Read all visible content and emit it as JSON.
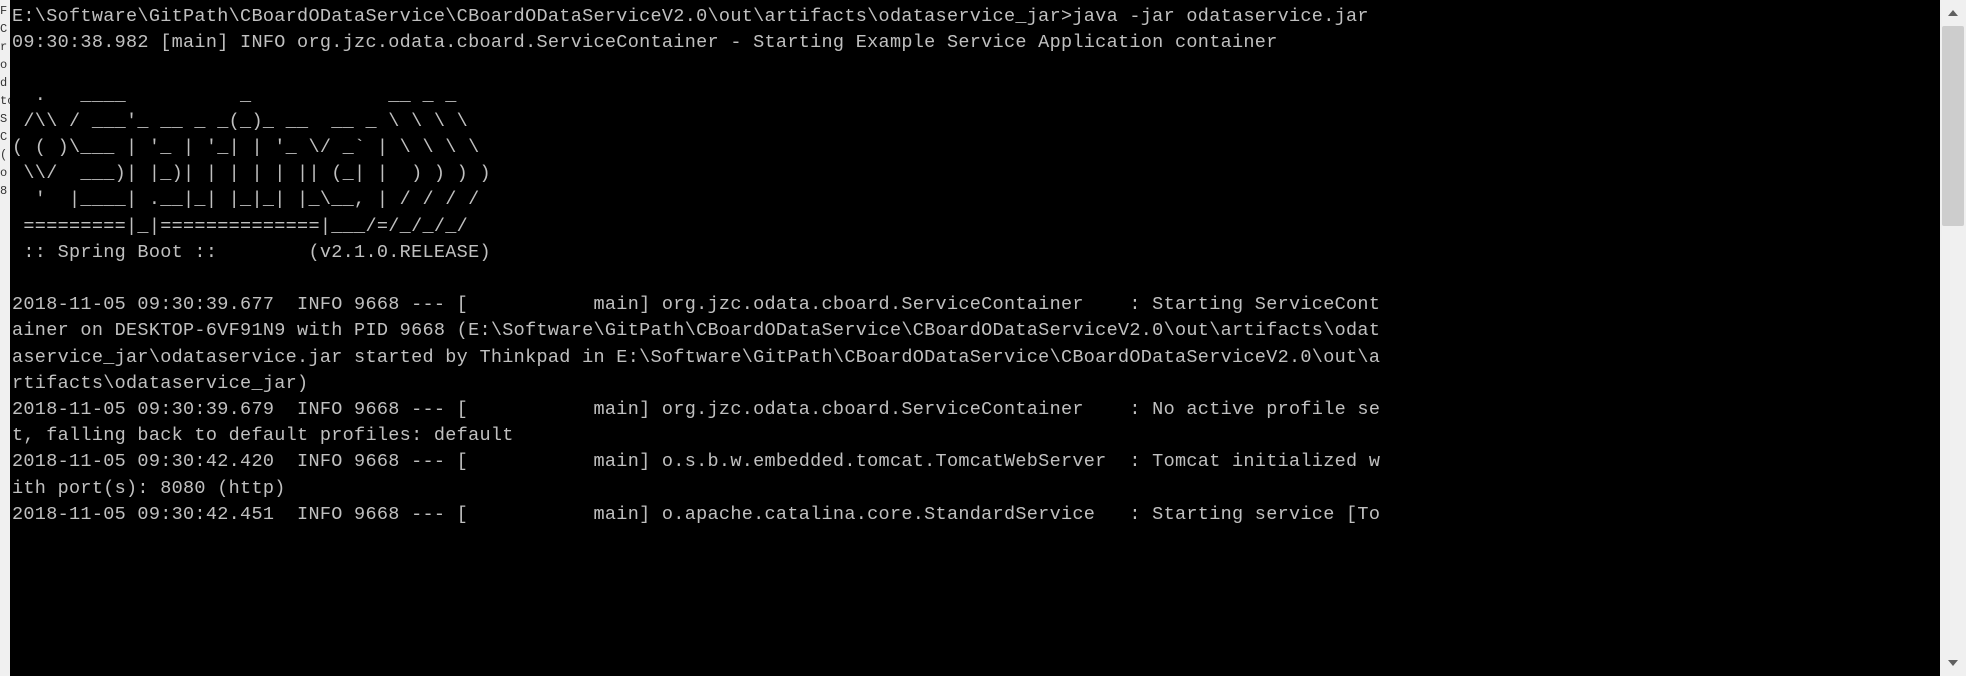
{
  "left_edge_text": "F\nC\n \nr\no\nd\nto\nS\nC\n(\no\n \n \n \n8",
  "terminal": {
    "prompt_line": "E:\\Software\\GitPath\\CBoardODataService\\CBoardODataServiceV2.0\\out\\artifacts\\odataservice_jar>java -jar odataservice.jar",
    "log_line_1": "09:30:38.982 [main] INFO org.jzc.odata.cboard.ServiceContainer - Starting Example Service Application container",
    "ascii_art": "  .   ____          _            __ _ _\n /\\\\ / ___'_ __ _ _(_)_ __  __ _ \\ \\ \\ \\\n( ( )\\___ | '_ | '_| | '_ \\/ _` | \\ \\ \\ \\\n \\\\/  ___)| |_)| | | | | || (_| |  ) ) ) )\n  '  |____| .__|_| |_|_| |_\\__, | / / / /\n =========|_|==============|___/=/_/_/_/\n :: Spring Boot ::        (v2.1.0.RELEASE)",
    "log_line_2": "2018-11-05 09:30:39.677  INFO 9668 --- [           main] org.jzc.odata.cboard.ServiceContainer    : Starting ServiceCont",
    "log_line_3": "ainer on DESKTOP-6VF91N9 with PID 9668 (E:\\Software\\GitPath\\CBoardODataService\\CBoardODataServiceV2.0\\out\\artifacts\\odat",
    "log_line_4": "aservice_jar\\odataservice.jar started by Thinkpad in E:\\Software\\GitPath\\CBoardODataService\\CBoardODataServiceV2.0\\out\\a",
    "log_line_5": "rtifacts\\odataservice_jar)",
    "log_line_6": "2018-11-05 09:30:39.679  INFO 9668 --- [           main] org.jzc.odata.cboard.ServiceContainer    : No active profile se",
    "log_line_7": "t, falling back to default profiles: default",
    "log_line_8": "2018-11-05 09:30:42.420  INFO 9668 --- [           main] o.s.b.w.embedded.tomcat.TomcatWebServer  : Tomcat initialized w",
    "log_line_9": "ith port(s): 8080 (http)",
    "log_line_10": "2018-11-05 09:30:42.451  INFO 9668 --- [           main] o.apache.catalina.core.StandardService   : Starting service [To"
  }
}
